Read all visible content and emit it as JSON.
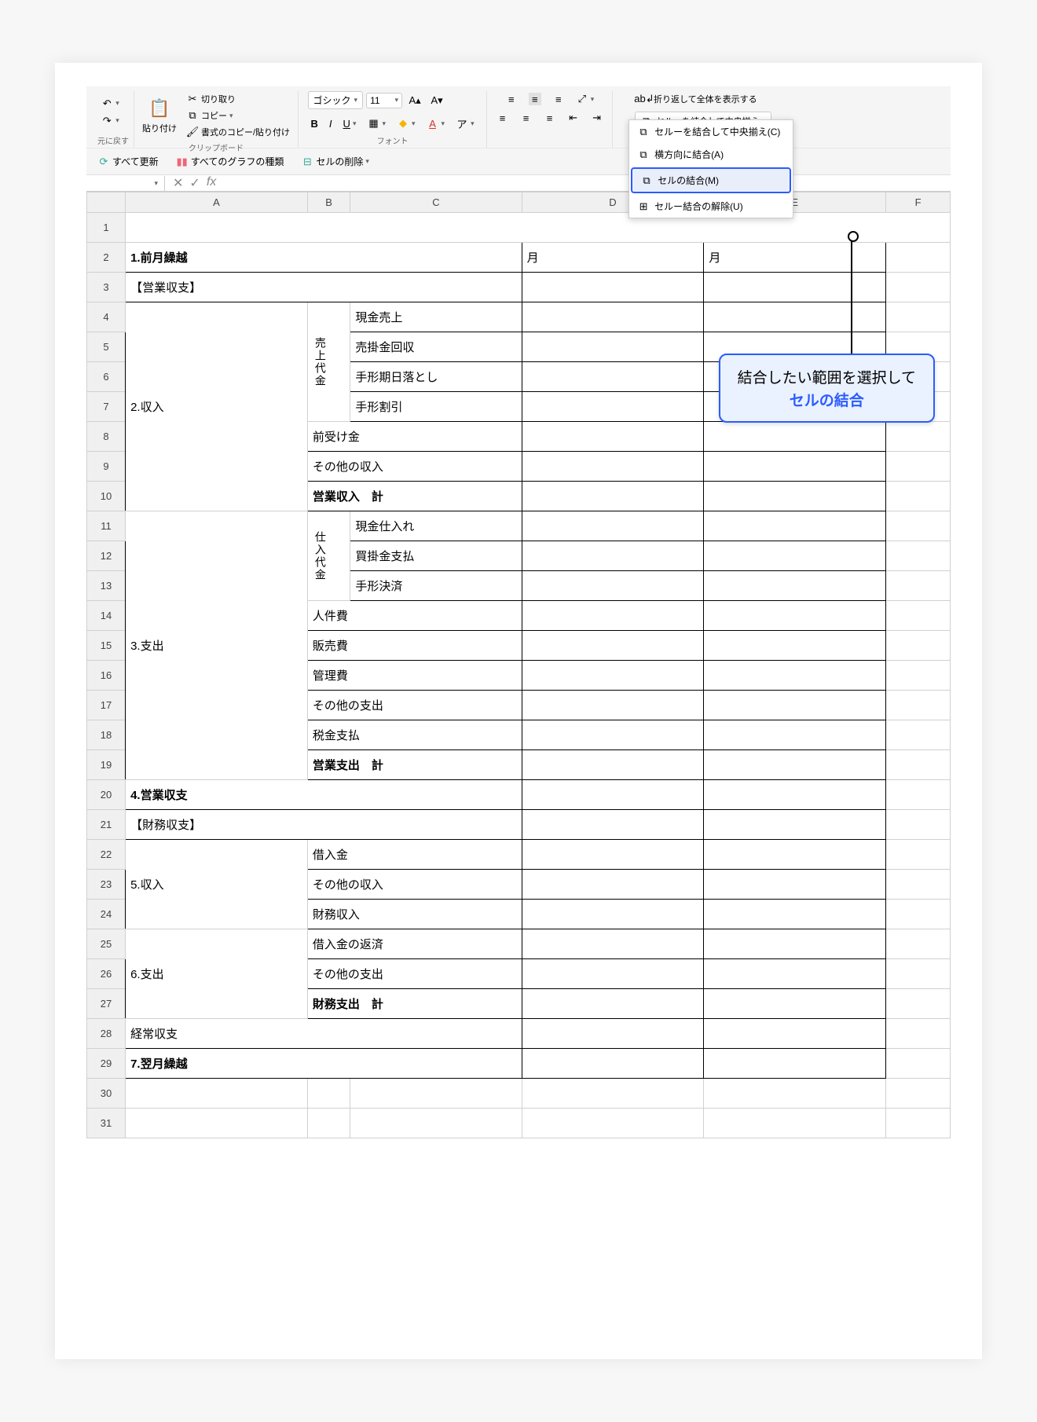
{
  "ribbon": {
    "undo_group": "元に戻す",
    "paste_label": "貼り付け",
    "cut": "切り取り",
    "copy": "コピー",
    "format_painter": "書式のコピー/貼り付け",
    "clipboard_group": "クリップボード",
    "font_name": "ゴシック",
    "font_size": "11",
    "font_group": "フォント",
    "wrap_text": "折り返して全体を表示する",
    "merge_center": "セルーを結合して中央揃え",
    "merge_menu": {
      "center": "セルーを結合して中央揃え(C)",
      "across": "横方向に結合(A)",
      "merge": "セルの結合(M)",
      "unmerge": "セルー結合の解除(U)"
    }
  },
  "toolbar2": {
    "refresh_all": "すべて更新",
    "all_chart_types": "すべてのグラフの種類",
    "delete_cells": "セルの削除"
  },
  "columns": [
    "A",
    "B",
    "C",
    "D",
    "E",
    "F"
  ],
  "rows": [
    1,
    2,
    3,
    4,
    5,
    6,
    7,
    8,
    9,
    10,
    11,
    12,
    13,
    14,
    15,
    16,
    17,
    18,
    19,
    20,
    21,
    22,
    23,
    24,
    25,
    26,
    27,
    28,
    29,
    30,
    31
  ],
  "cells": {
    "r2_A": "1.前月繰越",
    "r2_D": "月",
    "r2_E": "月",
    "r3_A": "【営業収支】",
    "r4_B": "売上代金",
    "r4_C": "現金売上",
    "r5_C": "売掛金回収",
    "r6_C": "手形期日落とし",
    "r7_C": "手形割引",
    "r7_A": "2.収入",
    "r8_BC": "前受け金",
    "r9_BC": "その他の収入",
    "r10_BC": "営業収入　計",
    "r11_B": "仕入代金",
    "r11_C": "現金仕入れ",
    "r12_C": "買掛金支払",
    "r13_C": "手形決済",
    "r15_A": "3.支出",
    "r14_BC": "人件費",
    "r15_BC": "販売費",
    "r16_BC": "管理費",
    "r17_BC": "その他の支出",
    "r18_BC": "税金支払",
    "r19_BC": "営業支出　計",
    "r20_A": "4.営業収支",
    "r21_A": "【財務収支】",
    "r23_A": "5.収入",
    "r22_BC": "借入金",
    "r23_BC": "その他の収入",
    "r24_BC": "財務収入",
    "r26_A": "6.支出",
    "r25_BC": "借入金の返済",
    "r26_BC": "その他の支出",
    "r27_BC": "財務支出　計",
    "r28_A": "経常収支",
    "r29_A": "7.翌月繰越"
  },
  "callout": {
    "line1": "結合したい範囲を選択して",
    "line2": "セルの結合"
  }
}
